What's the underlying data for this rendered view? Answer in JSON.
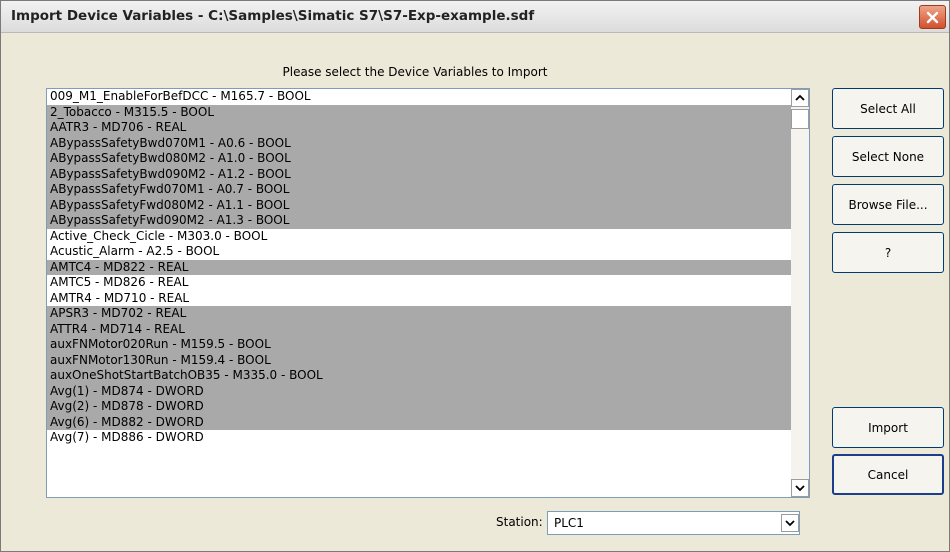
{
  "window": {
    "title": "Import Device Variables - C:\\Samples\\Simatic S7\\S7-Exp-example.sdf",
    "close_icon": "close-icon"
  },
  "instruction": "Please select the Device Variables to Import",
  "list": {
    "items": [
      {
        "label": "009_M1_EnableForBefDCC - M165.7 - BOOL",
        "selected": false
      },
      {
        "label": "2_Tobacco - M315.5 - BOOL",
        "selected": true
      },
      {
        "label": "AATR3 - MD706 - REAL",
        "selected": true
      },
      {
        "label": "ABypassSafetyBwd070M1 - A0.6 - BOOL",
        "selected": true
      },
      {
        "label": "ABypassSafetyBwd080M2 - A1.0 - BOOL",
        "selected": true
      },
      {
        "label": "ABypassSafetyBwd090M2 - A1.2 - BOOL",
        "selected": true
      },
      {
        "label": "ABypassSafetyFwd070M1 - A0.7 - BOOL",
        "selected": true
      },
      {
        "label": "ABypassSafetyFwd080M2 - A1.1 - BOOL",
        "selected": true
      },
      {
        "label": "ABypassSafetyFwd090M2 - A1.3 - BOOL",
        "selected": true
      },
      {
        "label": "Active_Check_Cicle - M303.0 - BOOL",
        "selected": false
      },
      {
        "label": "Acustic_Alarm - A2.5 - BOOL",
        "selected": false
      },
      {
        "label": "AMTC4 - MD822 - REAL",
        "selected": true
      },
      {
        "label": "AMTC5 - MD826 - REAL",
        "selected": false
      },
      {
        "label": "AMTR4 - MD710 - REAL",
        "selected": false
      },
      {
        "label": "APSR3 - MD702 - REAL",
        "selected": true
      },
      {
        "label": "ATTR4 - MD714 - REAL",
        "selected": true
      },
      {
        "label": "auxFNMotor020Run - M159.5 - BOOL",
        "selected": true
      },
      {
        "label": "auxFNMotor130Run - M159.4 - BOOL",
        "selected": true
      },
      {
        "label": "auxOneShotStartBatchOB35 - M335.0 - BOOL",
        "selected": true
      },
      {
        "label": "Avg(1) - MD874 - DWORD",
        "selected": true
      },
      {
        "label": "Avg(2) - MD878 - DWORD",
        "selected": true
      },
      {
        "label": "Avg(6) - MD882 - DWORD",
        "selected": true
      },
      {
        "label": "Avg(7) - MD886 - DWORD",
        "selected": false
      }
    ]
  },
  "buttons": {
    "select_all": "Select All",
    "select_none": "Select None",
    "browse_file": "Browse File...",
    "help": "?",
    "import": "Import",
    "cancel": "Cancel"
  },
  "station": {
    "label": "Station:",
    "value": "PLC1"
  },
  "colors": {
    "selected_row": "#a9a9a9",
    "dialog_bg": "#ece9d8",
    "close_button": "#d2502c"
  }
}
